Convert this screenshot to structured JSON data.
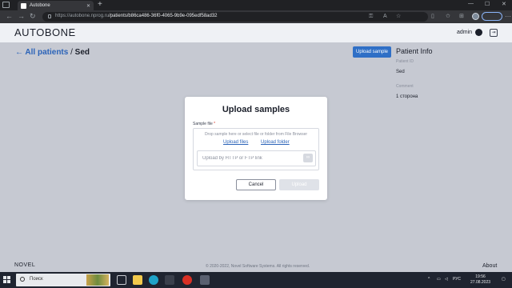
{
  "browser": {
    "tab_title": "Autobone",
    "url_host": "https://autobone.nprog.ru",
    "url_path": "/patients/b86ca486-36f0-4065-9b9e-095edf58ad32"
  },
  "app": {
    "logo": "AUTOBONE",
    "user": "admin",
    "breadcrumb": {
      "back_label": "All patients",
      "separator": "/",
      "current": "Sed"
    },
    "upload_button": "Upload sample",
    "patient_info": {
      "title": "Patient Info",
      "id_label": "Patient ID",
      "id_value": "Sed",
      "comment_label": "Comment",
      "comment_value": "1 сторона"
    },
    "footer": {
      "logo": "NOVEL",
      "copyright": "© 2020-2022, Novel Software Systems. All rights reserved.",
      "about": "About"
    }
  },
  "modal": {
    "title": "Upload samples",
    "field_label": "Sample file",
    "required_mark": "*",
    "drop_hint": "Drop sample here or select file or folder from File Browser",
    "upload_files": "Upload files",
    "upload_folder": "Upload folder",
    "url_placeholder": "Upload by HTTP or FTP link",
    "cancel": "Cancel",
    "upload": "Upload"
  },
  "taskbar": {
    "search_label": "Поиск",
    "lang": "РУС",
    "time": "19:56",
    "date": "27.08.2023"
  }
}
